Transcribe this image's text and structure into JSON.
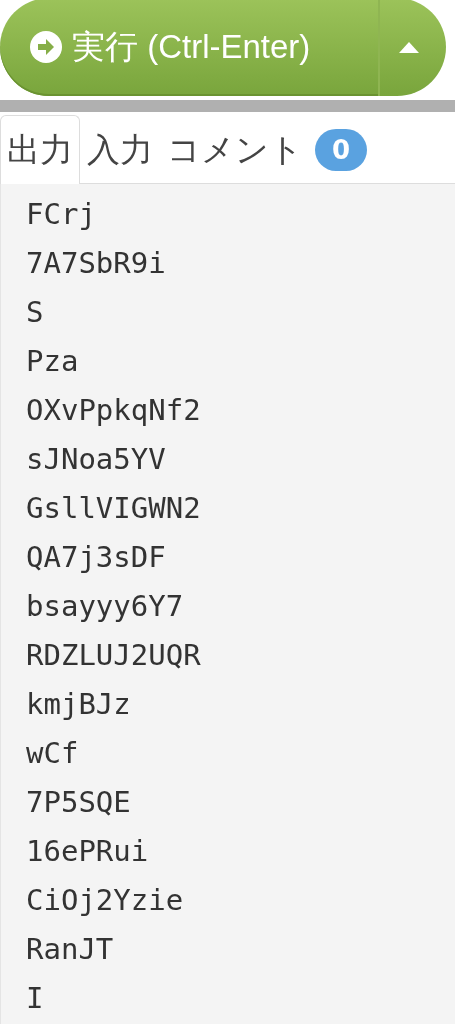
{
  "run_button": {
    "label": "実行 (Ctrl-Enter)"
  },
  "tabs": [
    {
      "label": "出力",
      "selected": true
    },
    {
      "label": "入力",
      "selected": false
    },
    {
      "label": "コメント",
      "selected": false,
      "badge": "0"
    }
  ],
  "output_lines": [
    "FCrj",
    "7A7SbR9i",
    "S",
    "Pza",
    "OXvPpkqNf2",
    "sJNoa5YV",
    "GsllVIGWN2",
    "QA7j3sDF",
    "bsayyy6Y7",
    "RDZLUJ2UQR",
    "kmjBJz",
    "wCf",
    "7P5SQE",
    "16ePRui",
    "CiOj2Yzie",
    "RanJT",
    "I"
  ]
}
